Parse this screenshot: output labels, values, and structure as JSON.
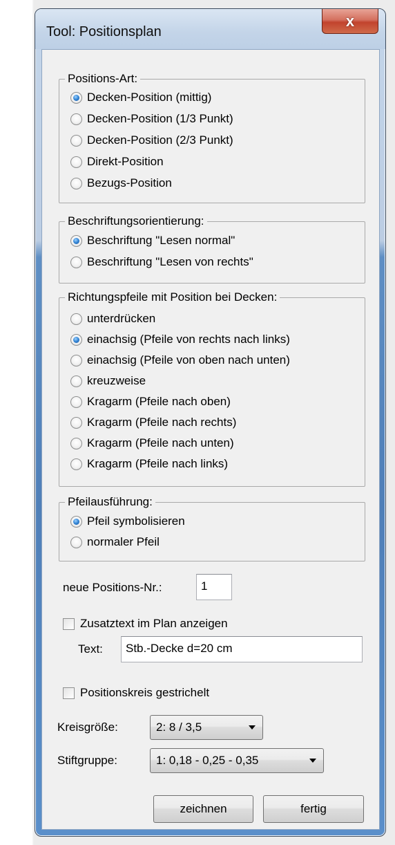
{
  "window": {
    "title": "Tool: Positionsplan",
    "close_label": "x"
  },
  "positions_art": {
    "legend": "Positions-Art:",
    "options": [
      {
        "label": "Decken-Position (mittig)",
        "checked": true
      },
      {
        "label": "Decken-Position (1/3 Punkt)",
        "checked": false
      },
      {
        "label": "Decken-Position (2/3 Punkt)",
        "checked": false
      },
      {
        "label": "Direkt-Position",
        "checked": false
      },
      {
        "label": "Bezugs-Position",
        "checked": false
      }
    ]
  },
  "beschriftung": {
    "legend": "Beschriftungsorientierung:",
    "options": [
      {
        "label": "Beschriftung \"Lesen normal\"",
        "checked": true
      },
      {
        "label": "Beschriftung \"Lesen von rechts\"",
        "checked": false
      }
    ]
  },
  "richtungspfeile": {
    "legend": "Richtungspfeile mit Position bei Decken:",
    "options": [
      {
        "label": "unterdrücken",
        "checked": false
      },
      {
        "label": "einachsig (Pfeile von rechts nach links)",
        "checked": true
      },
      {
        "label": "einachsig (Pfeile von oben nach unten)",
        "checked": false
      },
      {
        "label": "kreuzweise",
        "checked": false
      },
      {
        "label": "Kragarm (Pfeile nach oben)",
        "checked": false
      },
      {
        "label": "Kragarm (Pfeile nach rechts)",
        "checked": false
      },
      {
        "label": "Kragarm (Pfeile nach unten)",
        "checked": false
      },
      {
        "label": "Kragarm (Pfeile nach links)",
        "checked": false
      }
    ]
  },
  "pfeilausfuehrung": {
    "legend": "Pfeilausführung:",
    "options": [
      {
        "label": "Pfeil symbolisieren",
        "checked": true
      },
      {
        "label": "normaler Pfeil",
        "checked": false
      }
    ]
  },
  "neue_position": {
    "label": "neue Positions-Nr.:",
    "value": "1"
  },
  "zusatztext": {
    "label": "Zusatztext im Plan anzeigen",
    "checked": false
  },
  "text_field": {
    "label": "Text:",
    "value": "Stb.-Decke  d=20 cm"
  },
  "positionskreis": {
    "label": "Positionskreis gestrichelt",
    "checked": false
  },
  "kreisgroesse": {
    "label": "Kreisgröße:",
    "value": "2:  8 / 3,5"
  },
  "stiftgruppe": {
    "label": "Stiftgruppe:",
    "value": "1:  0,18 - 0,25 - 0,35"
  },
  "buttons": {
    "zeichnen": "zeichnen",
    "fertig": "fertig"
  }
}
